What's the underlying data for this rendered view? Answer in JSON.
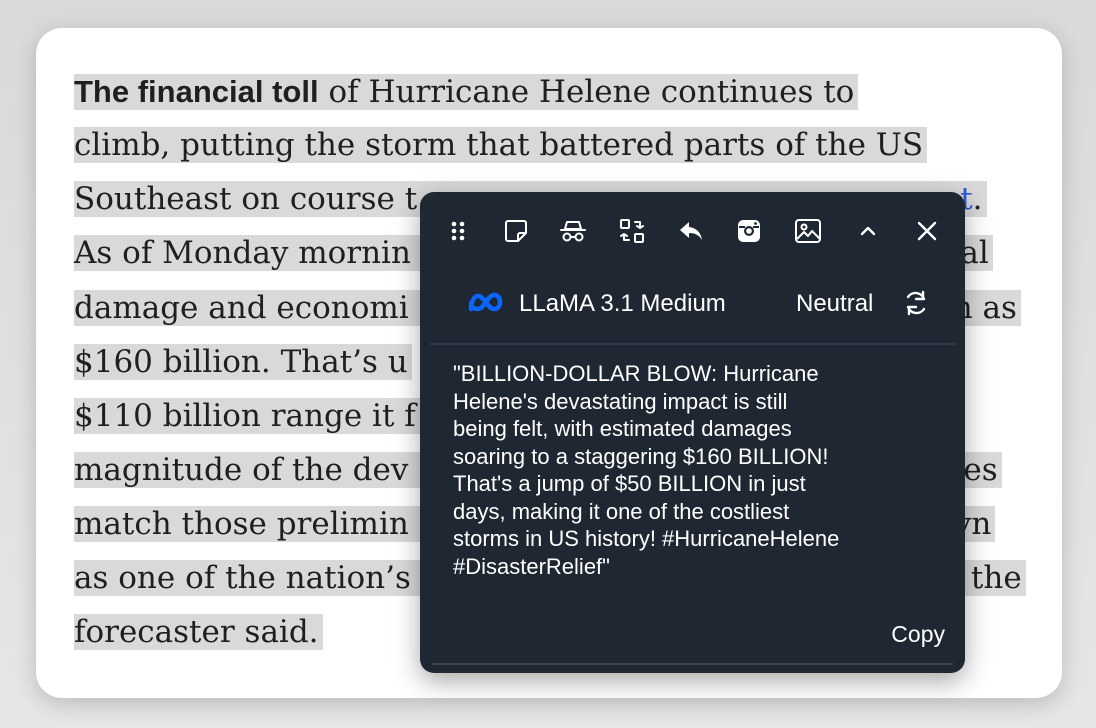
{
  "article": {
    "lines": [
      {
        "bold": "The financial toll",
        "text": " of Hurricane Helene continues to"
      },
      {
        "text": "climb, putting the storm that battered parts of the US"
      },
      {
        "text": "Southeast on course t",
        "link": "t",
        "end": "."
      },
      {
        "text": "As of Monday mornin",
        "end": "tal"
      },
      {
        "text": "damage and economi",
        "end": "n as"
      },
      {
        "text": "$160 billion. That’s u"
      },
      {
        "text": "$110 billion range it f"
      },
      {
        "text": "magnitude of the dev",
        "end": "es"
      },
      {
        "text": "match those prelimin",
        "end": "vn"
      },
      {
        "text": "as one of the nation’s",
        "end": "the"
      },
      {
        "text": "forecaster said."
      }
    ]
  },
  "popup": {
    "toolbar_icons": [
      "drag-handle-icon",
      "sticky-note-icon",
      "incognito-icon",
      "transform-icon",
      "reply-icon",
      "instagram-icon",
      "image-icon",
      "collapse-icon",
      "close-icon"
    ],
    "model_name": "LLaMA 3.1 Medium",
    "tone": "Neutral",
    "output": "\"BILLION-DOLLAR BLOW: Hurricane\nHelene's devastating impact is still\nbeing felt, with estimated damages\nsoaring to a staggering $160 BILLION!\nThat's a jump of $50 BILLION in just\ndays, making it one of the costliest\nstorms in US history! #HurricaneHelene\n#DisasterRelief\"",
    "copy_label": "Copy",
    "accent": "#0866ff"
  }
}
